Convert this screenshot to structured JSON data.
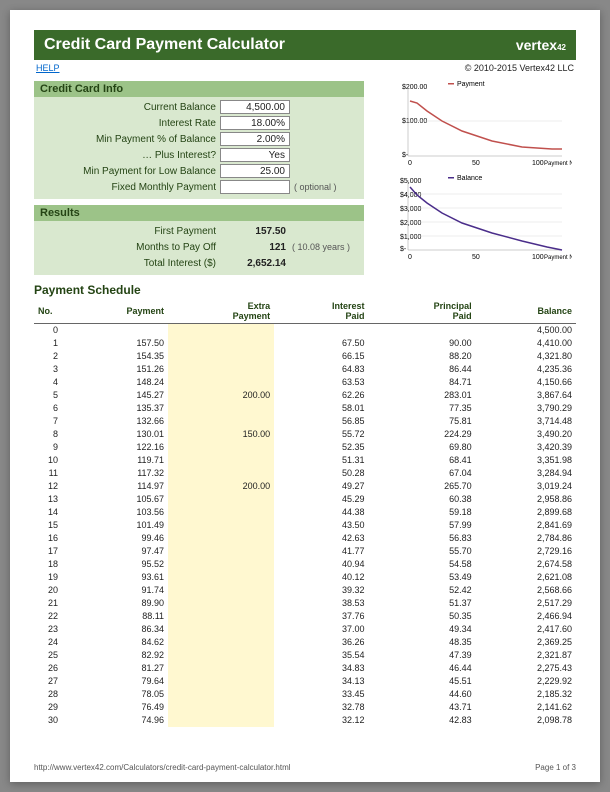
{
  "header": {
    "title": "Credit Card Payment Calculator",
    "logo_prefix": "vertex",
    "logo_suffix": "42",
    "help_link": "HELP",
    "copyright": "© 2010-2015 Vertex42 LLC"
  },
  "card_info": {
    "section_title": "Credit Card Info",
    "rows": [
      {
        "label": "Current Balance",
        "value": "4,500.00"
      },
      {
        "label": "Interest Rate",
        "value": "18.00%"
      },
      {
        "label": "Min Payment % of Balance",
        "value": "2.00%"
      },
      {
        "label": "… Plus Interest?",
        "value": "Yes"
      },
      {
        "label": "Min Payment for Low Balance",
        "value": "25.00"
      },
      {
        "label": "Fixed Monthly Payment",
        "value": "",
        "note": "( optional )"
      }
    ]
  },
  "results": {
    "section_title": "Results",
    "rows": [
      {
        "label": "First Payment",
        "value": "157.50"
      },
      {
        "label": "Months to Pay Off",
        "value": "121",
        "note": "( 10.08 years )"
      },
      {
        "label": "Total Interest ($)",
        "value": "2,652.14"
      }
    ]
  },
  "charts": {
    "payment": {
      "legend": "Payment",
      "ymax_label": "$200.00",
      "ymid_label": "$100.00",
      "ymin_label": "$-",
      "xmax_label": "100",
      "xmid_label": "50",
      "xmin_label": "0",
      "xlabel": "Payment No."
    },
    "balance": {
      "legend": "Balance",
      "ymax_label": "$5,000",
      "y4_label": "$4,000",
      "y3_label": "$3,000",
      "y2_label": "$2,000",
      "y1_label": "$1,000",
      "ymin_label": "$-",
      "xmax_label": "100",
      "xmid_label": "50",
      "xmin_label": "0",
      "xlabel": "Payment No."
    }
  },
  "schedule": {
    "title": "Payment Schedule",
    "headers": [
      "No.",
      "Payment",
      "Extra Payment",
      "Interest Paid",
      "Principal Paid",
      "Balance"
    ],
    "rows": [
      {
        "no": "0",
        "payment": "",
        "extra": "",
        "interest": "",
        "principal": "",
        "balance": "4,500.00"
      },
      {
        "no": "1",
        "payment": "157.50",
        "extra": "",
        "interest": "67.50",
        "principal": "90.00",
        "balance": "4,410.00"
      },
      {
        "no": "2",
        "payment": "154.35",
        "extra": "",
        "interest": "66.15",
        "principal": "88.20",
        "balance": "4,321.80"
      },
      {
        "no": "3",
        "payment": "151.26",
        "extra": "",
        "interest": "64.83",
        "principal": "86.44",
        "balance": "4,235.36"
      },
      {
        "no": "4",
        "payment": "148.24",
        "extra": "",
        "interest": "63.53",
        "principal": "84.71",
        "balance": "4,150.66"
      },
      {
        "no": "5",
        "payment": "145.27",
        "extra": "200.00",
        "interest": "62.26",
        "principal": "283.01",
        "balance": "3,867.64"
      },
      {
        "no": "6",
        "payment": "135.37",
        "extra": "",
        "interest": "58.01",
        "principal": "77.35",
        "balance": "3,790.29"
      },
      {
        "no": "7",
        "payment": "132.66",
        "extra": "",
        "interest": "56.85",
        "principal": "75.81",
        "balance": "3,714.48"
      },
      {
        "no": "8",
        "payment": "130.01",
        "extra": "150.00",
        "interest": "55.72",
        "principal": "224.29",
        "balance": "3,490.20"
      },
      {
        "no": "9",
        "payment": "122.16",
        "extra": "",
        "interest": "52.35",
        "principal": "69.80",
        "balance": "3,420.39"
      },
      {
        "no": "10",
        "payment": "119.71",
        "extra": "",
        "interest": "51.31",
        "principal": "68.41",
        "balance": "3,351.98"
      },
      {
        "no": "11",
        "payment": "117.32",
        "extra": "",
        "interest": "50.28",
        "principal": "67.04",
        "balance": "3,284.94"
      },
      {
        "no": "12",
        "payment": "114.97",
        "extra": "200.00",
        "interest": "49.27",
        "principal": "265.70",
        "balance": "3,019.24"
      },
      {
        "no": "13",
        "payment": "105.67",
        "extra": "",
        "interest": "45.29",
        "principal": "60.38",
        "balance": "2,958.86"
      },
      {
        "no": "14",
        "payment": "103.56",
        "extra": "",
        "interest": "44.38",
        "principal": "59.18",
        "balance": "2,899.68"
      },
      {
        "no": "15",
        "payment": "101.49",
        "extra": "",
        "interest": "43.50",
        "principal": "57.99",
        "balance": "2,841.69"
      },
      {
        "no": "16",
        "payment": "99.46",
        "extra": "",
        "interest": "42.63",
        "principal": "56.83",
        "balance": "2,784.86"
      },
      {
        "no": "17",
        "payment": "97.47",
        "extra": "",
        "interest": "41.77",
        "principal": "55.70",
        "balance": "2,729.16"
      },
      {
        "no": "18",
        "payment": "95.52",
        "extra": "",
        "interest": "40.94",
        "principal": "54.58",
        "balance": "2,674.58"
      },
      {
        "no": "19",
        "payment": "93.61",
        "extra": "",
        "interest": "40.12",
        "principal": "53.49",
        "balance": "2,621.08"
      },
      {
        "no": "20",
        "payment": "91.74",
        "extra": "",
        "interest": "39.32",
        "principal": "52.42",
        "balance": "2,568.66"
      },
      {
        "no": "21",
        "payment": "89.90",
        "extra": "",
        "interest": "38.53",
        "principal": "51.37",
        "balance": "2,517.29"
      },
      {
        "no": "22",
        "payment": "88.11",
        "extra": "",
        "interest": "37.76",
        "principal": "50.35",
        "balance": "2,466.94"
      },
      {
        "no": "23",
        "payment": "86.34",
        "extra": "",
        "interest": "37.00",
        "principal": "49.34",
        "balance": "2,417.60"
      },
      {
        "no": "24",
        "payment": "84.62",
        "extra": "",
        "interest": "36.26",
        "principal": "48.35",
        "balance": "2,369.25"
      },
      {
        "no": "25",
        "payment": "82.92",
        "extra": "",
        "interest": "35.54",
        "principal": "47.39",
        "balance": "2,321.87"
      },
      {
        "no": "26",
        "payment": "81.27",
        "extra": "",
        "interest": "34.83",
        "principal": "46.44",
        "balance": "2,275.43"
      },
      {
        "no": "27",
        "payment": "79.64",
        "extra": "",
        "interest": "34.13",
        "principal": "45.51",
        "balance": "2,229.92"
      },
      {
        "no": "28",
        "payment": "78.05",
        "extra": "",
        "interest": "33.45",
        "principal": "44.60",
        "balance": "2,185.32"
      },
      {
        "no": "29",
        "payment": "76.49",
        "extra": "",
        "interest": "32.78",
        "principal": "43.71",
        "balance": "2,141.62"
      },
      {
        "no": "30",
        "payment": "74.96",
        "extra": "",
        "interest": "32.12",
        "principal": "42.83",
        "balance": "2,098.78"
      }
    ]
  },
  "footer": {
    "url": "http://www.vertex42.com/Calculators/credit-card-payment-calculator.html",
    "page": "Page 1 of 3"
  },
  "chart_data": [
    {
      "type": "line",
      "title": "Payment",
      "xlabel": "Payment No.",
      "ylabel": "",
      "xlim": [
        0,
        121
      ],
      "ylim": [
        0,
        200
      ],
      "series": [
        {
          "name": "Payment",
          "color": "#c0504d",
          "x": [
            1,
            5,
            10,
            20,
            30,
            40,
            60,
            80,
            100,
            121
          ],
          "y": [
            157.5,
            145.27,
            119.71,
            91.74,
            74.96,
            61.3,
            41.0,
            29.0,
            25.0,
            25.0
          ]
        }
      ]
    },
    {
      "type": "line",
      "title": "Balance",
      "xlabel": "Payment No.",
      "ylabel": "",
      "xlim": [
        0,
        121
      ],
      "ylim": [
        0,
        5000
      ],
      "series": [
        {
          "name": "Balance",
          "color": "#4a2d8a",
          "x": [
            0,
            5,
            10,
            20,
            30,
            40,
            60,
            80,
            100,
            121
          ],
          "y": [
            4500,
            3867.64,
            3351.98,
            2568.66,
            2098.78,
            1715,
            1147,
            767,
            400,
            0
          ]
        }
      ]
    }
  ]
}
